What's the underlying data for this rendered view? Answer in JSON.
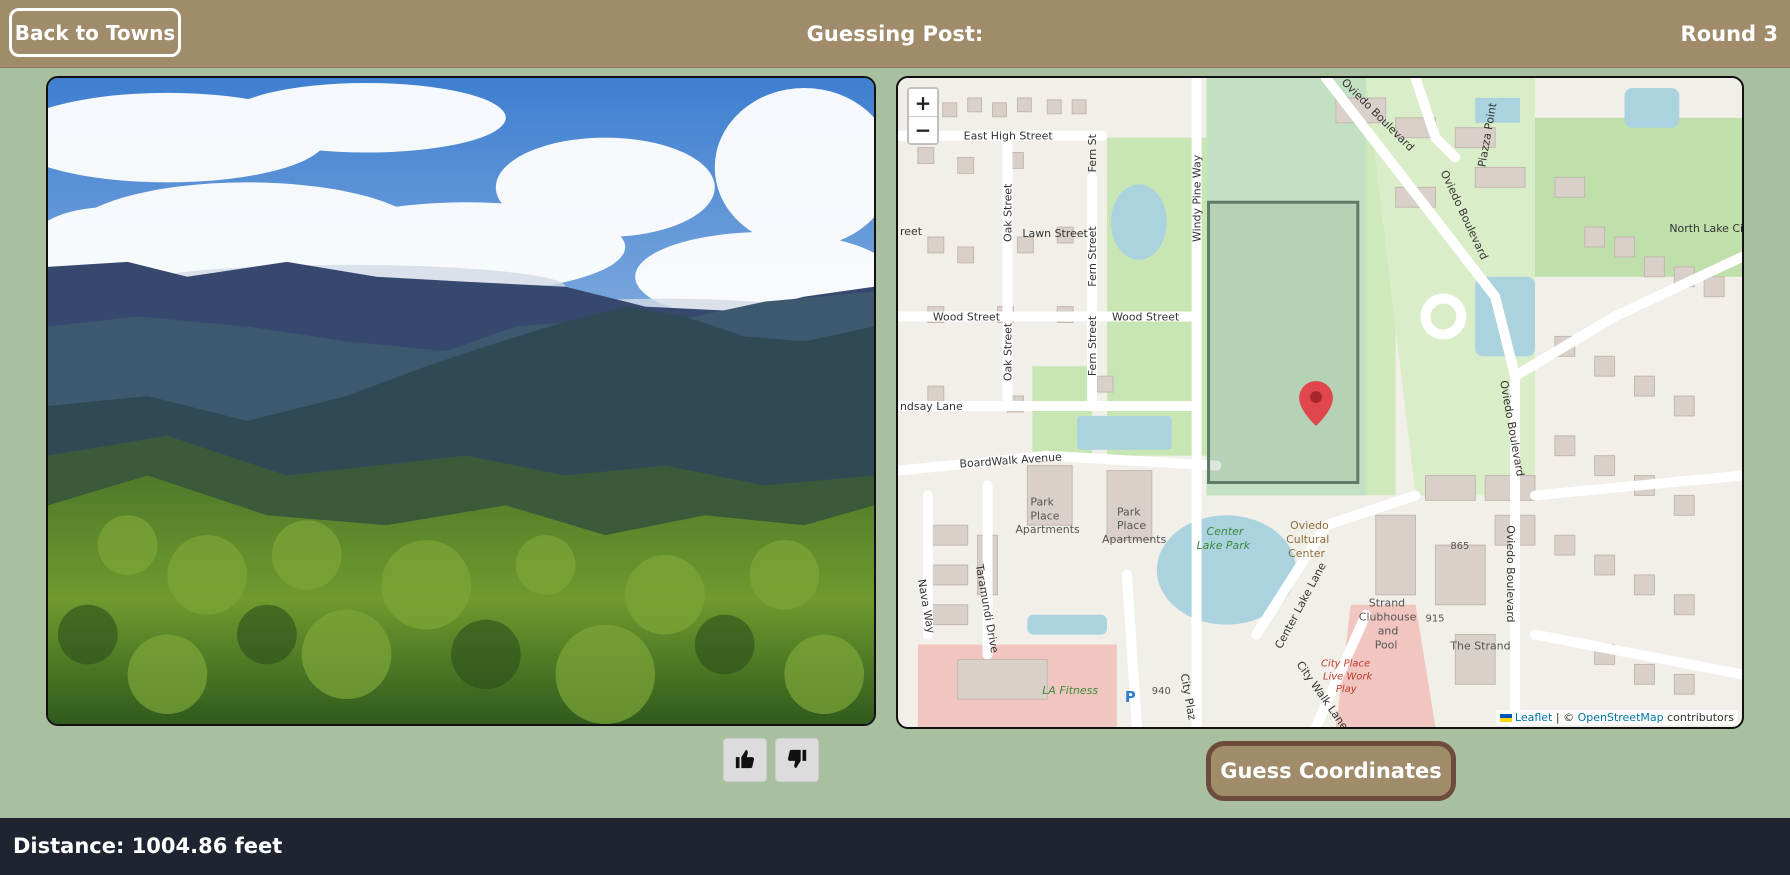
{
  "header": {
    "back_label": "Back to Towns",
    "title": "Guessing Post:",
    "round": "Round 3"
  },
  "photo": {
    "icon": "mountain-forest-landscape"
  },
  "map": {
    "zoom_in": "+",
    "zoom_out": "−",
    "streets": {
      "east_high": "East High Street",
      "lawn": "Lawn Street",
      "wood_1": "Wood Street",
      "wood_2": "Wood Street",
      "lindsay": "ndsay Lane",
      "boardwalk": "BoardWalk Avenue",
      "oak_1": "Oak Street",
      "oak_2": "Oak Street",
      "fern_1": "Fern Street",
      "fern_2": "Fern Street",
      "fern_top": "Fern St",
      "windy_pine": "Windy Pine Way",
      "oviedo_1": "Oviedo Boulevard",
      "oviedo_2": "Oviedo Boulevard",
      "oviedo_3": "Oviedo Boulevard",
      "oviedo_4": "Oviedo Boulevard",
      "piazza": "Piazza Point",
      "north_lake": "North Lake Ci",
      "nava": "Nava Way",
      "taramundi": "Taramundi Drive",
      "center_lake_lane": "Center Lake Lane",
      "city_walk": "City Walk Lane",
      "city_plaza": "City Plaz",
      "street_left": "reet"
    },
    "places": {
      "park_place_1a": "Park",
      "park_place_1b": "Place",
      "park_place_1c": "Apartments",
      "park_place_2a": "Park",
      "park_place_2b": "Place",
      "park_place_2c": "Apartments",
      "center_lake_park_1": "Center",
      "center_lake_park_2": "Lake Park",
      "cultural_1": "Oviedo",
      "cultural_2": "Cultural",
      "cultural_3": "Center",
      "strand_1": "Strand",
      "strand_2": "Clubhouse",
      "strand_3": "and",
      "strand_4": "Pool",
      "the_strand": "The Strand",
      "city_place_1": "City Place",
      "city_place_2": "Live Work",
      "city_place_3": "Play",
      "la_fitness": "LA Fitness",
      "num_865": "865",
      "num_915": "915",
      "num_940": "940",
      "parking": "P"
    },
    "attribution": {
      "leaflet": "Leaflet",
      "separator": " | © ",
      "osm": "OpenStreetMap",
      "contributors": " contributors"
    },
    "colors": {
      "marker": "#e0474c",
      "selection": "#5f7a66"
    }
  },
  "votes": {
    "up_icon": "thumbs-up-icon",
    "down_icon": "thumbs-down-icon"
  },
  "actions": {
    "guess_label": "Guess Coordinates"
  },
  "footer": {
    "distance": "Distance: 1004.86 feet"
  }
}
